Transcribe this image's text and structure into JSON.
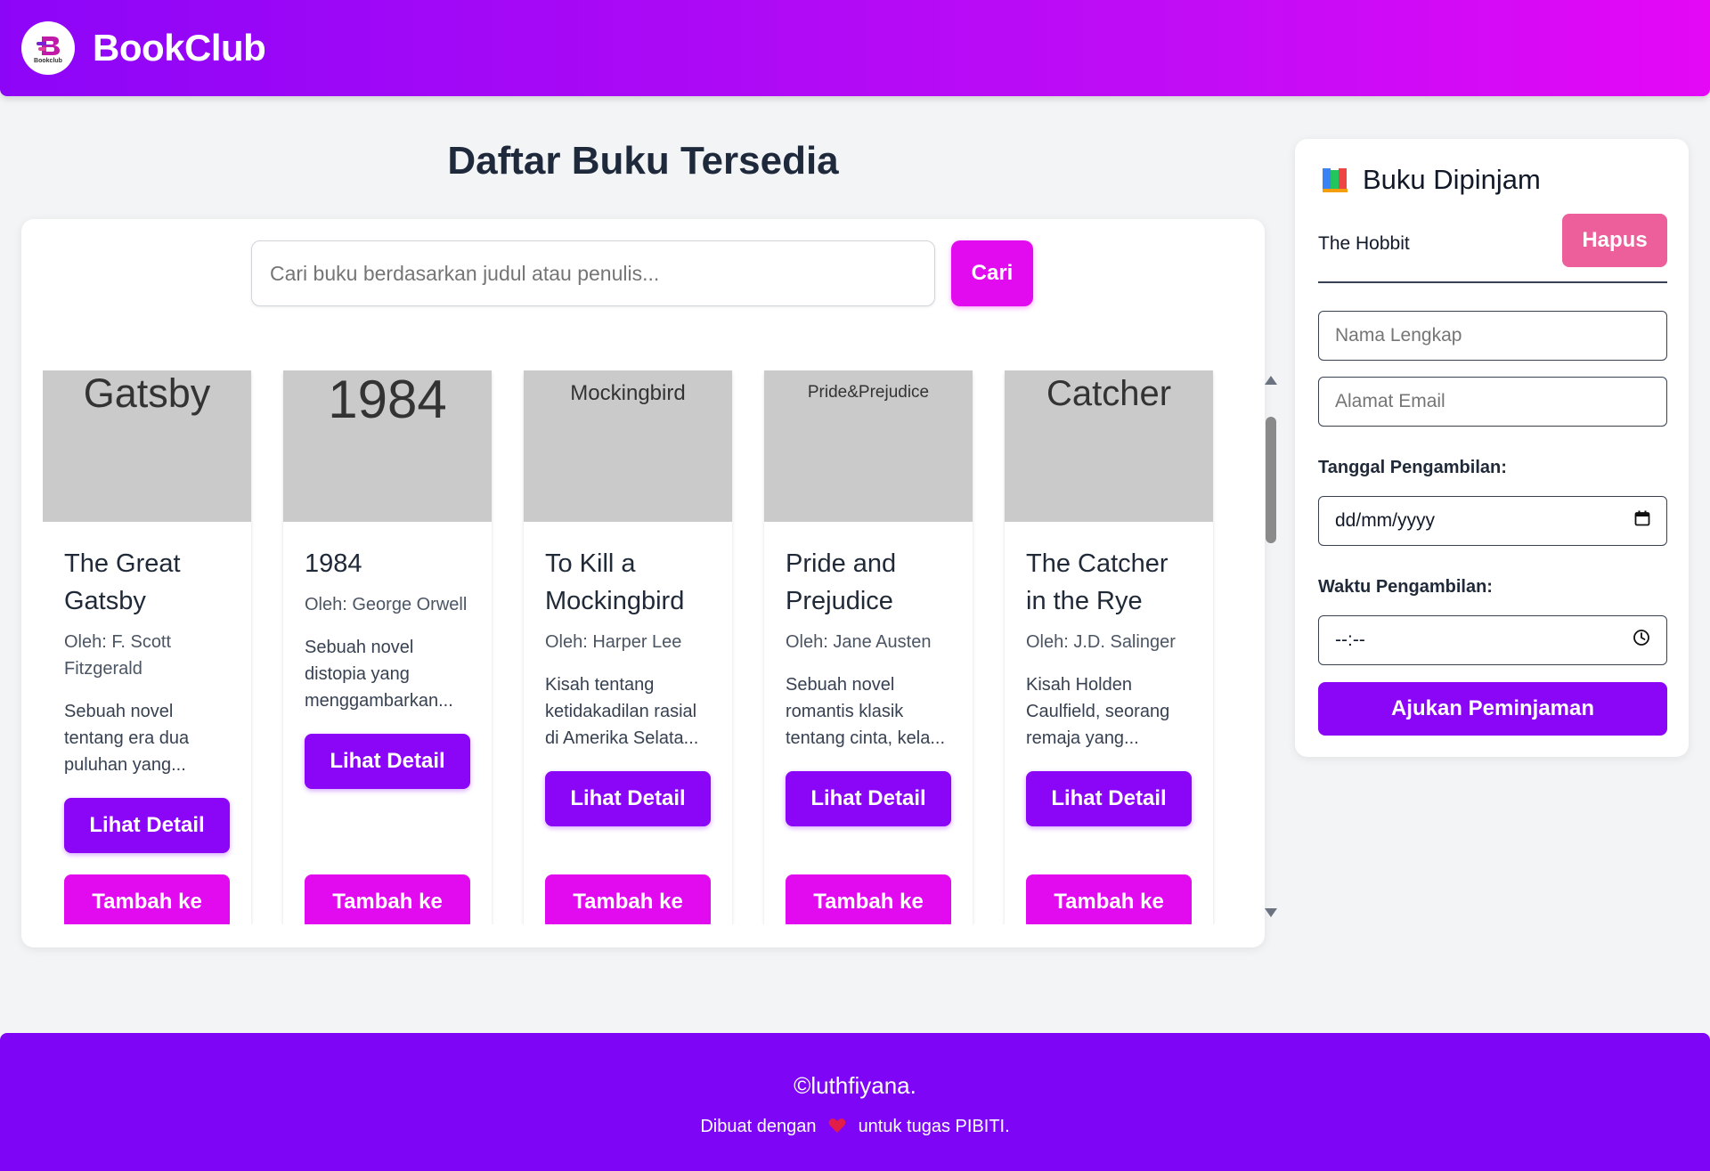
{
  "header": {
    "logo_small": "Bookclub",
    "brand": "BookClub"
  },
  "main": {
    "title": "Daftar Buku Tersedia",
    "search": {
      "placeholder": "Cari buku berdasarkan judul atau penulis...",
      "button_label": "Cari"
    },
    "books": [
      {
        "cover_text": "Gatsby",
        "title": "The Great Gatsby",
        "author": "Oleh: F. Scott Fitzgerald",
        "description": "Sebuah novel tentang era dua puluhan yang...",
        "detail_label": "Lihat Detail",
        "add_label": "Tambah ke"
      },
      {
        "cover_text": "1984",
        "title": "1984",
        "author": "Oleh: George Orwell",
        "description": "Sebuah novel distopia yang menggambarkan...",
        "detail_label": "Lihat Detail",
        "add_label": "Tambah ke"
      },
      {
        "cover_text": "Mockingbird",
        "title": "To Kill a Mockingbird",
        "author": "Oleh: Harper Lee",
        "description": "Kisah tentang ketidakadilan rasial di Amerika Selata...",
        "detail_label": "Lihat Detail",
        "add_label": "Tambah ke"
      },
      {
        "cover_text": "Pride&Prejudice",
        "title": "Pride and Prejudice",
        "author": "Oleh: Jane Austen",
        "description": "Sebuah novel romantis klasik tentang cinta, kela...",
        "detail_label": "Lihat Detail",
        "add_label": "Tambah ke"
      },
      {
        "cover_text": "Catcher",
        "title": "The Catcher in the Rye",
        "author": "Oleh: J.D. Salinger",
        "description": "Kisah Holden Caulfield, seorang remaja yang...",
        "detail_label": "Lihat Detail",
        "add_label": "Tambah ke"
      }
    ]
  },
  "sidebar": {
    "title": "Buku Dipinjam",
    "borrowed": [
      {
        "title": "The Hobbit",
        "remove_label": "Hapus"
      }
    ],
    "form": {
      "name_placeholder": "Nama Lengkap",
      "email_placeholder": "Alamat Email",
      "date_label": "Tanggal Pengambilan:",
      "date_value": "dd/mm/yyyy",
      "time_label": "Waktu Pengambilan:",
      "time_value": "--:--",
      "submit_label": "Ajukan Peminjaman"
    }
  },
  "footer": {
    "copyright": "©luthfiyana.",
    "made_prefix": "Dibuat dengan",
    "made_suffix": "untuk tugas PIBITI."
  },
  "colors": {
    "primary": "#8b05f6",
    "accent": "#e20bf0",
    "danger": "#ec5f9a",
    "footer": "#7f05f6"
  }
}
